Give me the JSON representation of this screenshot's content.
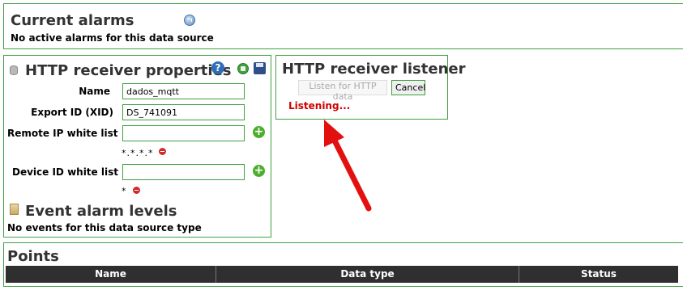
{
  "alarms": {
    "title": "Current alarms",
    "message": "No active alarms for this data source"
  },
  "properties": {
    "title": "HTTP receiver properties",
    "help_glyph": "?",
    "fields": {
      "name_label": "Name",
      "name_value": "dados_mqtt",
      "xid_label": "Export ID (XID)",
      "xid_value": "DS_741091",
      "remote_ip_label": "Remote IP white list",
      "remote_ip_value": "",
      "remote_ip_entry": "*.*.*.*",
      "device_id_label": "Device ID white list",
      "device_id_value": "",
      "device_id_entry": "*"
    },
    "add_glyph": "+",
    "event_title": "Event alarm levels",
    "event_message": "No events for this data source type"
  },
  "listener": {
    "title": "HTTP receiver listener",
    "listen_label": "Listen for HTTP data",
    "cancel_label": "Cancel",
    "status": "Listening..."
  },
  "points": {
    "title": "Points",
    "columns": [
      "Name",
      "Data type",
      "Status"
    ]
  },
  "colors": {
    "border": "#3fa13f",
    "status": "#d10000",
    "header_bg": "#2f2f2f",
    "arrow": "#e31010"
  }
}
